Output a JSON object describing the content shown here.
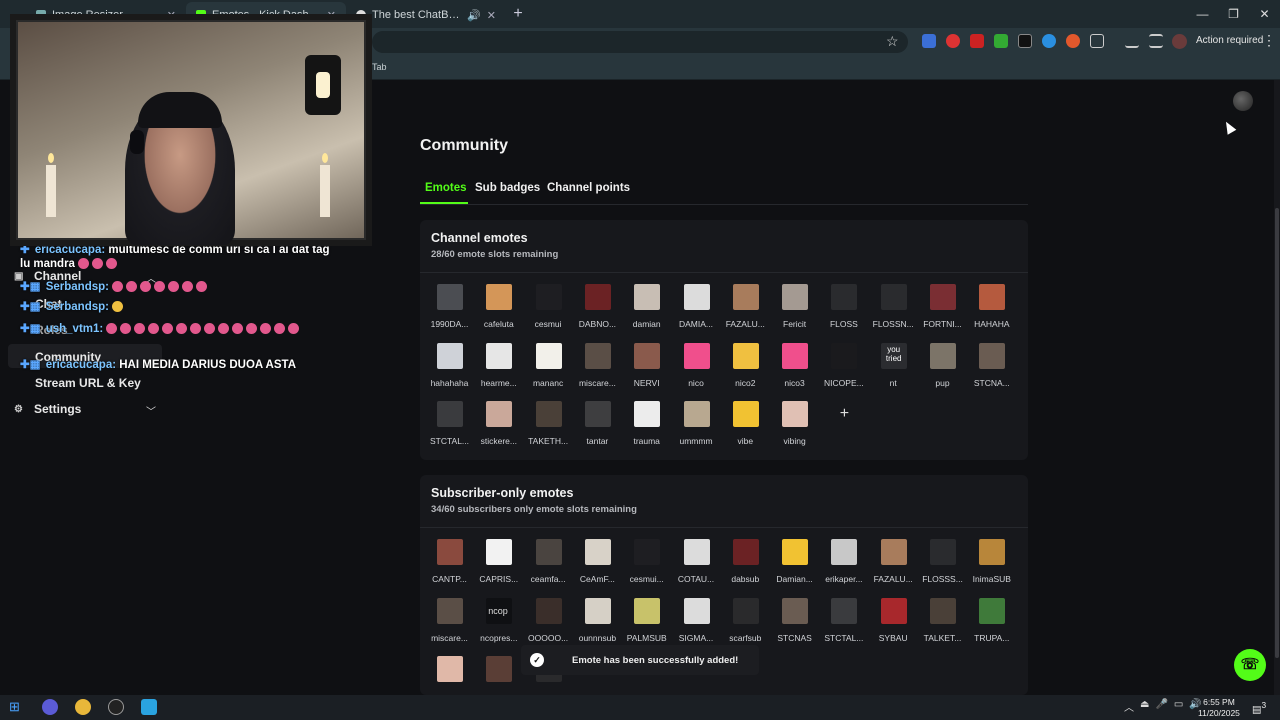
{
  "browser": {
    "tabs": [
      {
        "label": "Image Resizer"
      },
      {
        "label": "Emotes - Kick Dashboard"
      },
      {
        "label": "The best ChatBot and Widg"
      }
    ],
    "new_tab": "+",
    "action_required": "Action required",
    "bookmark_tab": "Tab"
  },
  "sidebar": {
    "channel": "Channel",
    "chat": "Chat",
    "roles": "Roles",
    "community": "Community",
    "stream_url": "Stream URL & Key",
    "settings": "Settings"
  },
  "chat_overlay": [
    {
      "user": "ericacucapa:",
      "text": "multumesc de comm uri si ca l ai dat tag"
    },
    {
      "user": "",
      "text": "lu mandra"
    },
    {
      "user": "Serbandsp:",
      "text": ""
    },
    {
      "user": "Serbandsp:",
      "text": ""
    },
    {
      "user": "ush_vtm1:",
      "text": ""
    },
    {
      "user": "ericacucapa:",
      "text": "HAI MEDIA DARIUS DUOA ASTA"
    }
  ],
  "main": {
    "title": "Community",
    "tabs": [
      "Emotes",
      "Sub badges",
      "Channel points"
    ],
    "channel_emotes": {
      "title": "Channel emotes",
      "subtitle": "28/60 emote slots remaining",
      "items": [
        {
          "name": "1990DA...",
          "color": "#4b4d52"
        },
        {
          "name": "cafeluta",
          "color": "#d49658"
        },
        {
          "name": "cesmui",
          "color": "#1e1e22"
        },
        {
          "name": "DABNO...",
          "color": "#6b2224"
        },
        {
          "name": "damian",
          "color": "#c8beb4"
        },
        {
          "name": "DAMIA...",
          "color": "#dcdcdc"
        },
        {
          "name": "FAZALU...",
          "color": "#a87c5c"
        },
        {
          "name": "Fericit",
          "color": "#a49a92"
        },
        {
          "name": "FLOSS",
          "color": "#2a2b2e"
        },
        {
          "name": "FLOSSN...",
          "color": "#2a2b2e"
        },
        {
          "name": "FORTNI...",
          "color": "#7a2e33"
        },
        {
          "name": "HAHAHA",
          "color": "#b55a3e"
        },
        {
          "name": "hahahaha",
          "color": "#cfd2d8"
        },
        {
          "name": "hearme...",
          "color": "#e6e6e6"
        },
        {
          "name": "mananc",
          "color": "#f2f0ea"
        },
        {
          "name": "miscare...",
          "color": "#5a4e46"
        },
        {
          "name": "NERVI",
          "color": "#8a5a4c"
        },
        {
          "name": "nico",
          "color": "#f04f8c"
        },
        {
          "name": "nico2",
          "color": "#f0c040"
        },
        {
          "name": "nico3",
          "color": "#f04f8c"
        },
        {
          "name": "NICOPE...",
          "color": "#1a1a1d"
        },
        {
          "name": "nt",
          "color": "#2b2c30"
        },
        {
          "name": "pup",
          "color": "#7c7468"
        },
        {
          "name": "STCNA...",
          "color": "#6a5c52"
        },
        {
          "name": "STCTAL...",
          "color": "#3a3b3e"
        },
        {
          "name": "stickere...",
          "color": "#caa89a"
        },
        {
          "name": "TAKETH...",
          "color": "#4a4038"
        },
        {
          "name": "tantar",
          "color": "#3e3e40"
        },
        {
          "name": "trauma",
          "color": "#ececec"
        },
        {
          "name": "ummmm",
          "color": "#b8a890"
        },
        {
          "name": "vibe",
          "color": "#f1c232"
        },
        {
          "name": "vibing",
          "color": "#e0c0b4"
        }
      ],
      "nt_overlay": "you tried",
      "add_label": "+"
    },
    "subscriber_emotes": {
      "title": "Subscriber-only emotes",
      "subtitle": "34/60 subscribers only emote slots remaining",
      "items": [
        {
          "name": "CANTP...",
          "color": "#8a4a3e"
        },
        {
          "name": "CAPRIS...",
          "color": "#f2f2f2"
        },
        {
          "name": "ceamfa...",
          "color": "#4a4440"
        },
        {
          "name": "CeAmF...",
          "color": "#d8d2c8"
        },
        {
          "name": "cesmui...",
          "color": "#1e1e22"
        },
        {
          "name": "COTAU...",
          "color": "#dcdcdc"
        },
        {
          "name": "dabsub",
          "color": "#6b2224"
        },
        {
          "name": "Damian...",
          "color": "#f1c232"
        },
        {
          "name": "erikaper...",
          "color": "#c8c8c8"
        },
        {
          "name": "FAZALU...",
          "color": "#a87c5c"
        },
        {
          "name": "FLOSSS...",
          "color": "#2a2b2e"
        },
        {
          "name": "InimaSUB",
          "color": "#b8863a"
        },
        {
          "name": "miscare...",
          "color": "#5a4e46"
        },
        {
          "name": "ncopres...",
          "color": "#0f1013"
        },
        {
          "name": "OOOOO...",
          "color": "#3a2e2a"
        },
        {
          "name": "ounnnsub",
          "color": "#d6d0c6"
        },
        {
          "name": "PALMSUB",
          "color": "#c8c26a"
        },
        {
          "name": "SIGMA...",
          "color": "#dcdcdc"
        },
        {
          "name": "scarfsub",
          "color": "#2a2a2c"
        },
        {
          "name": "STCNAS",
          "color": "#6a5c52"
        },
        {
          "name": "STCTAL...",
          "color": "#3a3b3e"
        },
        {
          "name": "SYBAU",
          "color": "#a8282c"
        },
        {
          "name": "TALKET...",
          "color": "#4a4038"
        },
        {
          "name": "TRUPA...",
          "color": "#3f7a3a"
        },
        {
          "name": "",
          "color": "#e0b8a8"
        },
        {
          "name": "",
          "color": "#5a3e36"
        },
        {
          "name": "",
          "color": "#2a2a2c"
        }
      ],
      "broken_img_alt": "ncop"
    },
    "toast": "Emote has been successfully added!"
  },
  "taskbar": {
    "time": "6:55 PM",
    "date": "11/20/2025",
    "notif_count": "3"
  },
  "colors": {
    "accent": "#53fc18",
    "bg": "#0f1013",
    "card": "#17181c"
  }
}
